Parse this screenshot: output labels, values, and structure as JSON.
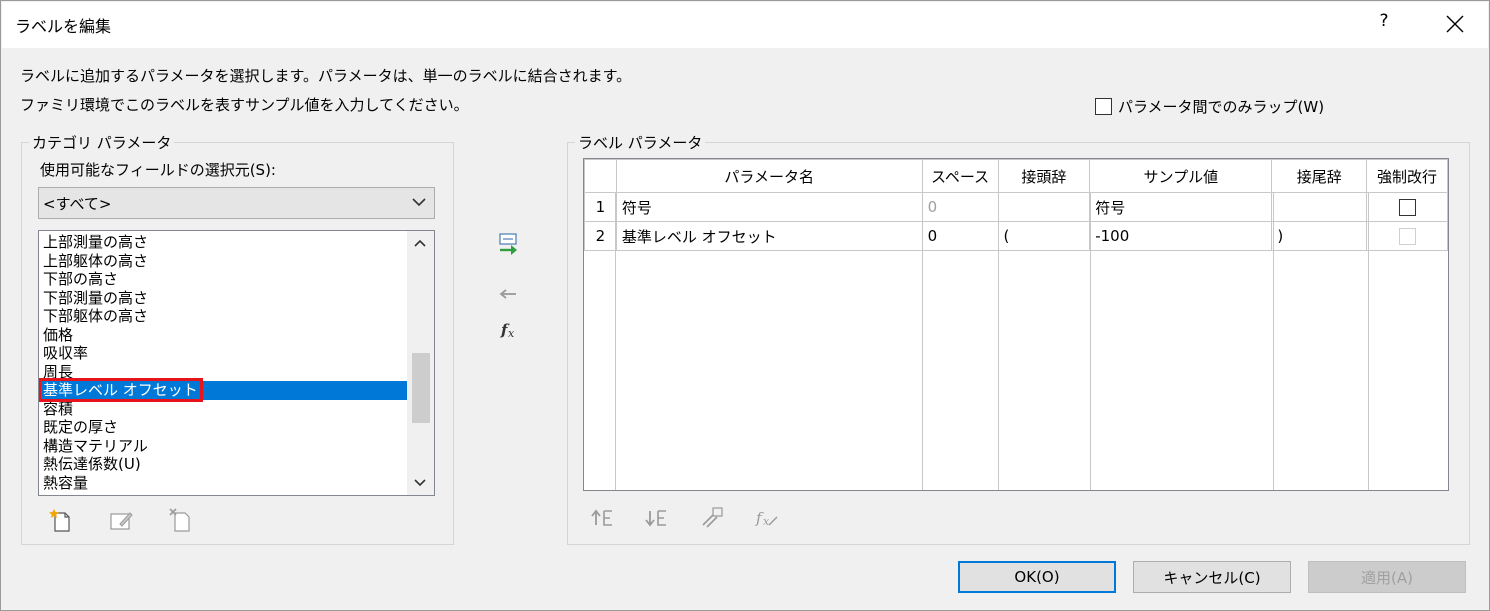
{
  "dialog": {
    "title": "ラベルを編集",
    "help": "?",
    "instruction1": "ラベルに追加するパラメータを選択します。パラメータは、単一のラベルに結合されます。",
    "instruction2": "ファミリ環境でこのラベルを表すサンプル値を入力してください。",
    "wrap_option_label": "パラメータ間でのみラップ(W)"
  },
  "category": {
    "group_label": "カテゴリ パラメータ",
    "field_label": "使用可能なフィールドの選択元(S):",
    "combo_value": "<すべて>",
    "items": [
      "上部測量の高さ",
      "上部躯体の高さ",
      "下部の高さ",
      "下部測量の高さ",
      "下部躯体の高さ",
      "価格",
      "吸収率",
      "周長",
      "基準レベル オフセット",
      "容積",
      "既定の厚さ",
      "構造マテリアル",
      "熱伝達係数(U)",
      "熱容量"
    ],
    "selected_index": 8
  },
  "label_params": {
    "group_label": "ラベル パラメータ",
    "columns": [
      "パラメータ名",
      "スペース",
      "接頭辞",
      "サンプル値",
      "接尾辞",
      "強制改行"
    ],
    "rows": [
      {
        "num": "1",
        "name": "符号",
        "space": "0",
        "prefix": "",
        "sample": "符号",
        "suffix": ""
      },
      {
        "num": "2",
        "name": "基準レベル オフセット",
        "space": "0",
        "prefix": "(",
        "sample": "-100",
        "suffix": ")"
      }
    ]
  },
  "buttons": {
    "ok": "OK(O)",
    "cancel": "キャンセル(C)",
    "apply": "適用(A)"
  },
  "colors": {
    "accent": "#0078d7",
    "highlight_border": "#e8141b",
    "add_arrow": "#2e9e3e"
  }
}
